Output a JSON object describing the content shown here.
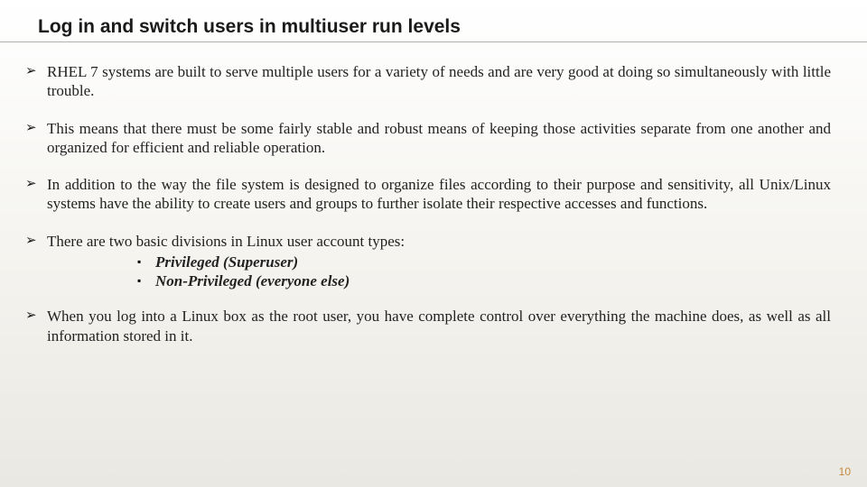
{
  "title": "Log in and switch users in multiuser run levels",
  "bullets": {
    "b1": "RHEL 7 systems are built to serve multiple users for a variety of needs and are very good at doing so simultaneously with little trouble.",
    "b2": "This means that there must be some fairly stable and robust means of keeping those activities separate from one another and organized for efficient and reliable operation.",
    "b3": "In addition to the way the file system is designed to organize files according to their purpose and sensitivity, all Unix/Linux systems have the ability to create users and groups to further isolate their respective accesses and functions.",
    "b4": "There are two basic divisions in Linux user account types:",
    "b5": "When you log into a Linux box as the root user, you have complete control over everything the machine does, as well as all information stored in it."
  },
  "sub": {
    "s1": "Privileged (Superuser)",
    "s2": "Non-Privileged (everyone else)"
  },
  "pageNumber": "10"
}
